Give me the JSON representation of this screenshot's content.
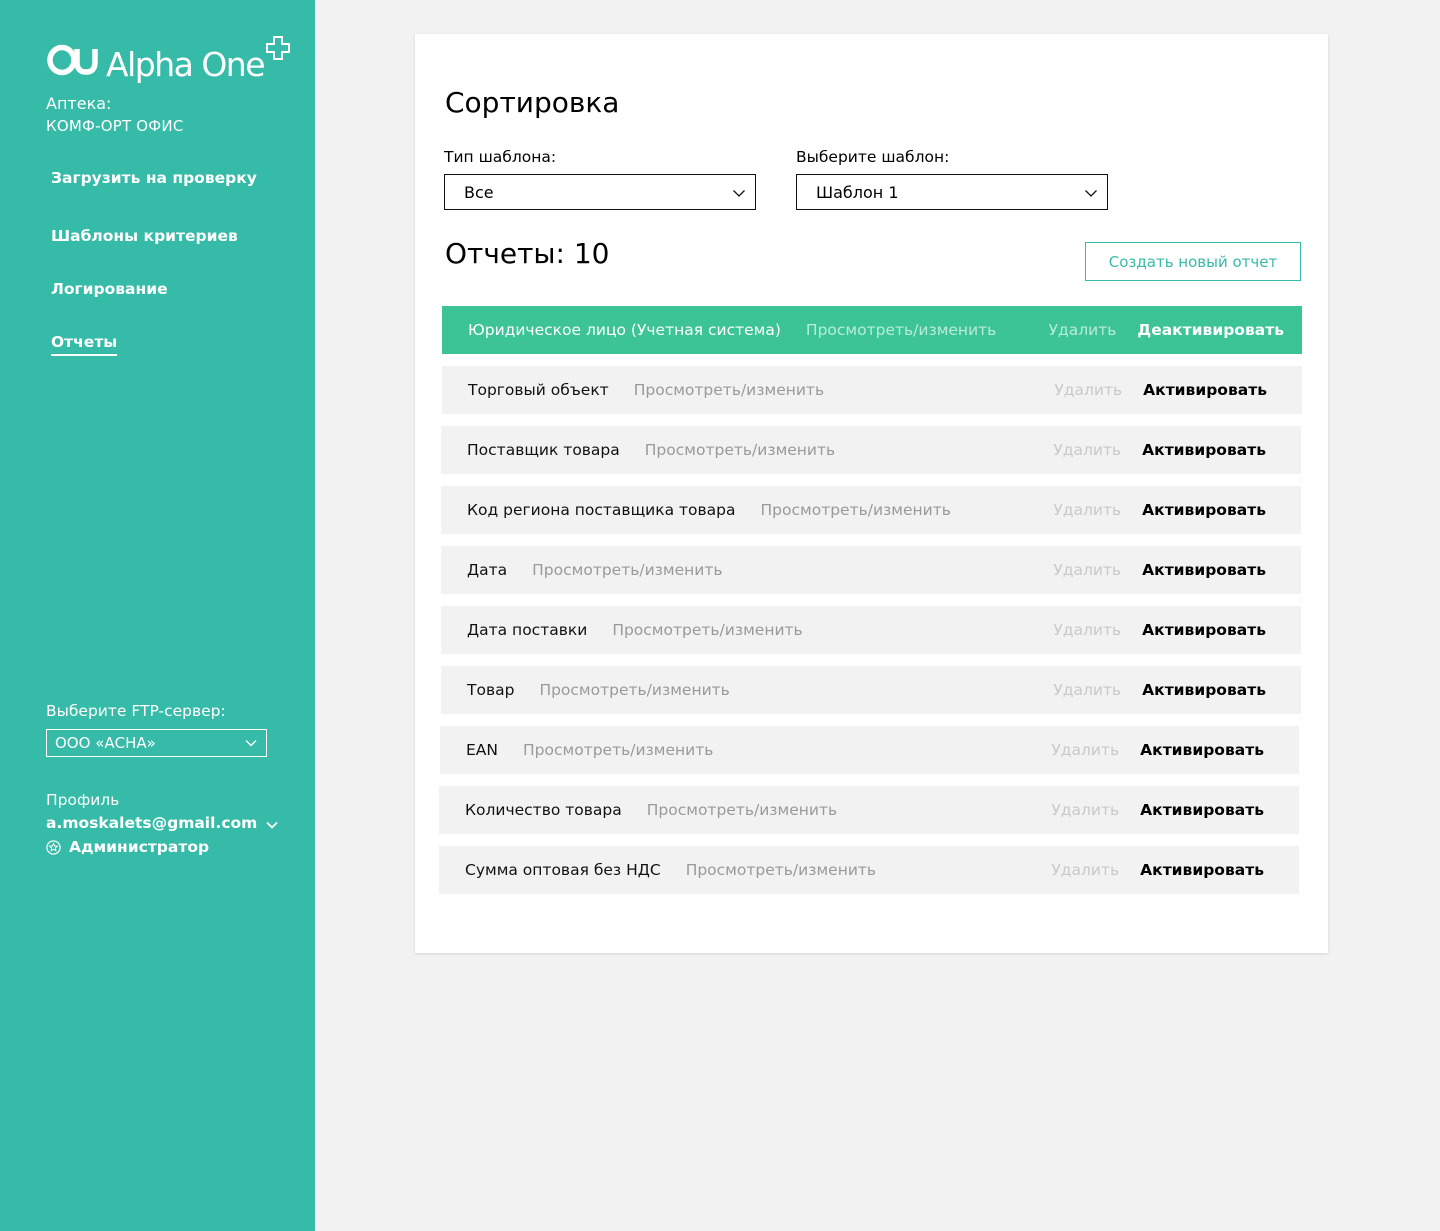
{
  "brand": {
    "name": "Alpha One"
  },
  "sidebar": {
    "pharmacy_label": "Аптека:",
    "pharmacy_name": "КОМФ-ОРТ ОФИС",
    "nav": [
      {
        "label": "Загрузить на проверку"
      },
      {
        "label": "Шаблоны критериев"
      },
      {
        "label": "Логирование"
      },
      {
        "label": "Отчеты",
        "active": true
      }
    ],
    "ftp_label": "Выберите FTP-сервер:",
    "ftp_value": "ООО «АСНА»",
    "profile_label": "Профиль",
    "profile_email": "a.moskalets@gmail.com",
    "profile_role": "Администратор"
  },
  "main": {
    "title": "Сортировка",
    "template_type_label": "Тип шаблона:",
    "template_type_value": "Все",
    "template_label": "Выберите шаблон:",
    "template_value": "Шаблон 1",
    "reports_count": "Отчеты: 10",
    "create_button": "Создать новый отчет",
    "view_label": "Просмотреть/изменить",
    "delete_label": "Удалить",
    "rows": [
      {
        "name": "Юридическое лицо (Учетная система)",
        "action": "Деактивировать",
        "active": true
      },
      {
        "name": "Торговый объект",
        "action": "Активировать"
      },
      {
        "name": "Поставщик товара",
        "action": "Активировать"
      },
      {
        "name": "Код региона поставщика товара",
        "action": "Активировать"
      },
      {
        "name": "Дата",
        "action": "Активировать"
      },
      {
        "name": "Дата поставки",
        "action": "Активировать"
      },
      {
        "name": "Товар",
        "action": "Активировать"
      },
      {
        "name": "EAN",
        "action": "Активировать"
      },
      {
        "name": "Количество товара",
        "action": "Активировать"
      },
      {
        "name": "Сумма оптовая без НДС",
        "action": "Активировать"
      }
    ]
  },
  "colors": {
    "sidebar_bg": "#36bba8",
    "accent": "#3cc497",
    "page_bg": "#f2f2f2",
    "row_bg": "#f2f2f2"
  },
  "icons": [
    "alpha-one-logo-icon",
    "plus-icon",
    "chevron-down-icon",
    "admin-star-icon"
  ]
}
